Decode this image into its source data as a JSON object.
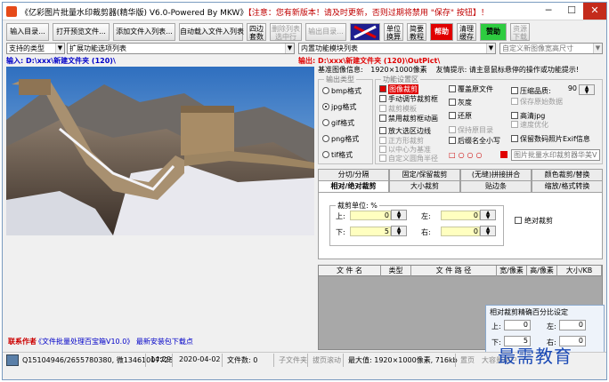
{
  "titlebar": {
    "title": "《亿彩图片批量水印裁剪器(精华版) V6.0-Powered By MKW》",
    "notice": "【注意：您有新版本！请及时更新，否则过期将禁用 \"保存\" 按钮】！",
    "minimize": "─",
    "maximize": "☐",
    "close": "✕"
  },
  "toolbar": {
    "import_dir": "输入目录...",
    "open_preview": "打开预览文件...",
    "add_files": "添加文件入列表...",
    "auto_load": "自动载入文件入列表",
    "four_align": [
      "四边",
      "套数"
    ],
    "delete_selected": [
      "删除列表",
      "选中行"
    ],
    "output_dir": "输出目录...",
    "unit_convert": [
      "单位",
      "换算"
    ],
    "tutorial": [
      "简要",
      "教程"
    ],
    "red_button": "帮助",
    "clear_tasks": [
      "清理",
      "缓存"
    ],
    "donate": "赞助",
    "resource": [
      "资源",
      "下载"
    ]
  },
  "row2": {
    "type_combo": "支持的类型",
    "ext_combo": "扩展功能选项列表",
    "builtin_combo": "内置功能模块列表",
    "custom_combo": "自定义新图像宽高尺寸"
  },
  "paths": {
    "input": "输入: D:\\xxx\\新建文件夹 (120)\\",
    "output": "输出: D:\\xxx\\新建文件夹 (120)\\OutPict\\",
    "base_info_label": "基准图像信息:",
    "base_info_value": "1920×1000像素",
    "tip": "友情提示: 请主意鼠标悬停的操作或功能提示!"
  },
  "format_group": {
    "title": "输出类型",
    "options": [
      "bmp格式",
      "jpg格式",
      "gif格式",
      "png格式",
      "tif格式"
    ],
    "selected": 1
  },
  "function_group": {
    "title": "功能设置区",
    "col1": [
      {
        "label": "图像裁剪",
        "checked": true,
        "disabled": false
      },
      {
        "label": "手动调节裁剪框",
        "checked": false,
        "disabled": false
      },
      {
        "label": "裁剪模板",
        "checked": false,
        "disabled": true
      },
      {
        "label": "禁用裁剪框动画",
        "checked": false,
        "disabled": false
      },
      {
        "label": "放大选区边线",
        "checked": false,
        "disabled": false
      },
      {
        "label": "正方形裁剪",
        "checked": false,
        "disabled": true
      },
      {
        "label": "以中心为基准",
        "checked": false,
        "disabled": true
      },
      {
        "label": "自定义圆角半径",
        "checked": false,
        "disabled": true
      }
    ],
    "col2": [
      {
        "label": "覆盖原文件",
        "checked": false,
        "disabled": false
      },
      {
        "label": "灰度",
        "checked": false,
        "disabled": false
      },
      {
        "label": "还原",
        "checked": false,
        "disabled": false
      },
      {
        "label": "保持原目录",
        "checked": false,
        "disabled": true
      },
      {
        "label": "后缀名全小写",
        "checked": false,
        "disabled": false
      }
    ],
    "col3": [
      {
        "label": "压缩品质:",
        "checked": false,
        "disabled": false
      },
      {
        "label": "保存原始数据",
        "checked": false,
        "disabled": true
      },
      {
        "label": "高清jpg",
        "checked": false,
        "disabled": false
      },
      {
        "label": "速度优化",
        "checked": false,
        "disabled": true
      },
      {
        "label": "保留数码照片Exif信息",
        "checked": false,
        "disabled": false
      }
    ],
    "quality": "90",
    "watermark_note": "图片批量水印裁剪器华美V",
    "shape_labels": [
      "□",
      "○",
      "○",
      "○"
    ]
  },
  "tabs_row1": [
    "分切/分隔",
    "固定/保留裁剪",
    "(无缝)拼接拼合",
    "颜色裁剪/替换"
  ],
  "tabs_row2": [
    "相对/绝对裁剪",
    "大小裁剪",
    "贴边条",
    "缩放/格式转换"
  ],
  "crop_panel": {
    "unit_label": "裁剪单位: %",
    "top": "上:",
    "left": "左:",
    "bottom": "下:",
    "right": "右:",
    "top_value": "0",
    "left_value": "0",
    "bottom_value": "5",
    "right_value": "0",
    "absolute": "绝对裁剪"
  },
  "file_table": {
    "columns": [
      "文 件 名",
      "类型",
      "文 件 路 径",
      "宽/像素",
      "高/像素",
      "大小/KB"
    ]
  },
  "popup": {
    "title": "相对裁剪精确百分比设定",
    "top": "上:",
    "left": "左:",
    "bottom": "下:",
    "right": "右:",
    "top_value": "0",
    "left_value": "0",
    "bottom_value": "5",
    "right_value": "0"
  },
  "bottom_link": {
    "label": "联系作者",
    "text": "《文件批量处理百宝箱V10.0》 最新安装包下载点"
  },
  "status": {
    "qq": "Q15104946/2655780380, 微13461007723",
    "time": "14:29",
    "date": "2020-04-02",
    "file_count": "文件数: 0",
    "subfiles": "子文件夹",
    "drag_mode": "拔页滚动",
    "max_size": "最大值: 1920×1000像素, 716kb",
    "page": "置页",
    "extra": "大容量用户"
  },
  "watermark_text": "最需教育"
}
